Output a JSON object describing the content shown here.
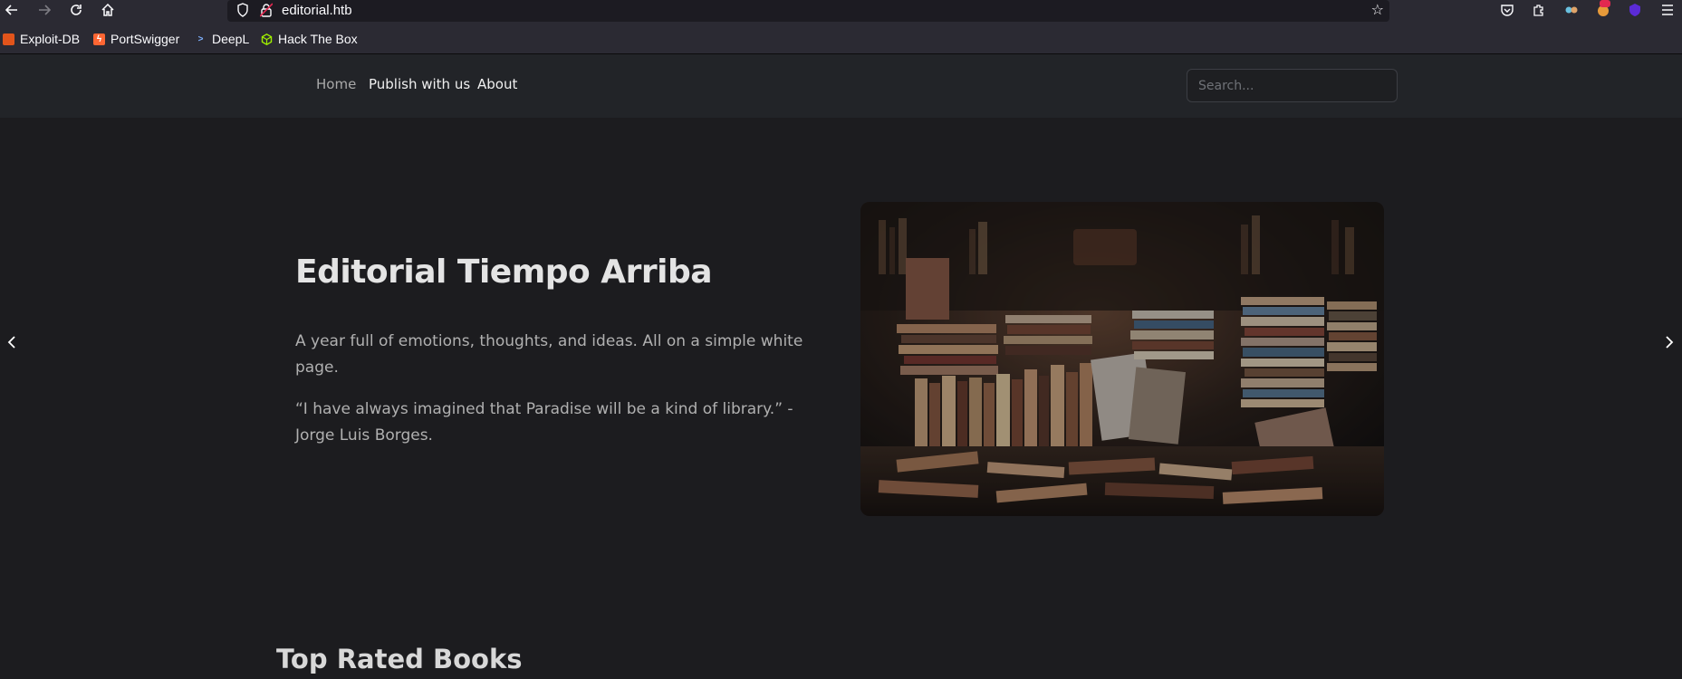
{
  "browser": {
    "url": "editorial.htb",
    "bookmarks": [
      {
        "label": "Exploit-DB",
        "icon": "exploit-db-icon",
        "color": "#e2541b"
      },
      {
        "label": "PortSwigger",
        "icon": "portswigger-icon",
        "color": "#ff6633"
      },
      {
        "label": "DeepL",
        "icon": "deepl-icon",
        "color": "#0f2b46"
      },
      {
        "label": "Hack The Box",
        "icon": "hackthebox-icon",
        "color": "#9fef00"
      }
    ]
  },
  "nav": {
    "links": [
      "Home",
      "Publish with us",
      "About"
    ],
    "search_placeholder": "Search..."
  },
  "hero": {
    "title": "Editorial Tiempo Arriba",
    "paragraph1": "A year full of emotions, thoughts, and ideas. All on a simple white page.",
    "paragraph2": "“I have always imagined that Paradise will be a kind of library.” - Jorge Luis Borges."
  },
  "sections": {
    "top_rated_title": "Top Rated Books"
  },
  "colors": {
    "page_bg": "#1c1c1f",
    "nav_bg": "#222428",
    "chrome_bg": "#2b2a33"
  }
}
